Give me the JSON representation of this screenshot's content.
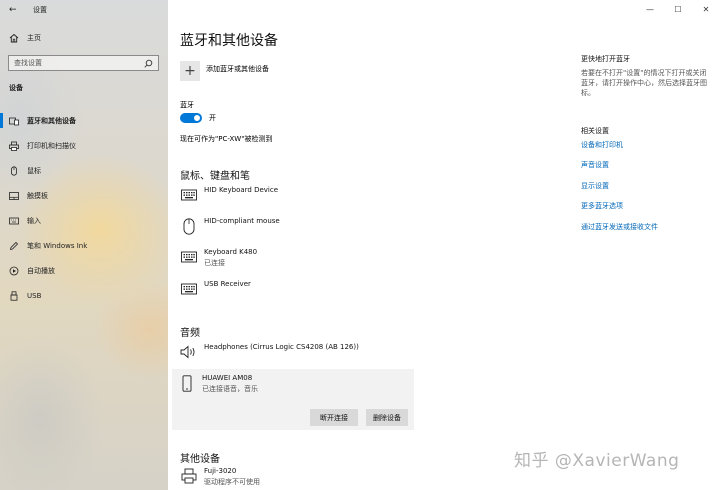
{
  "window": {
    "title": "设置",
    "back": "←",
    "controls": {
      "minimize": "—",
      "maximize": "☐",
      "close": "✕"
    }
  },
  "sidebar": {
    "home_label": "主页",
    "search_placeholder": "查找设置",
    "section_label": "设备",
    "items": [
      {
        "label": "蓝牙和其他设备",
        "icon": "bluetooth-devices-icon",
        "active": true
      },
      {
        "label": "打印机和扫描仪",
        "icon": "printer-icon"
      },
      {
        "label": "鼠标",
        "icon": "mouse-icon"
      },
      {
        "label": "触摸板",
        "icon": "touchpad-icon"
      },
      {
        "label": "输入",
        "icon": "keyboard-icon"
      },
      {
        "label": "笔和 Windows Ink",
        "icon": "pen-icon"
      },
      {
        "label": "自动播放",
        "icon": "autoplay-icon"
      },
      {
        "label": "USB",
        "icon": "usb-icon"
      }
    ]
  },
  "main": {
    "title": "蓝牙和其他设备",
    "add_device": {
      "icon": "plus-icon",
      "label": "添加蓝牙或其他设备"
    },
    "bluetooth": {
      "label": "蓝牙",
      "toggle_state": "开",
      "on": true,
      "discoverable_text": "现在可作为\"PC-XW\"被检测到"
    },
    "groups": [
      {
        "title": "鼠标、键盘和笔",
        "devices": [
          {
            "name": "HID Keyboard Device",
            "status": "",
            "icon": "keyboard-icon"
          },
          {
            "name": "HID-compliant mouse",
            "status": "",
            "icon": "mouse-icon"
          },
          {
            "name": "Keyboard K480",
            "status": "已连接",
            "icon": "keyboard-icon"
          },
          {
            "name": "USB Receiver",
            "status": "",
            "icon": "keyboard-icon"
          }
        ]
      },
      {
        "title": "音频",
        "devices": [
          {
            "name": "Headphones (Cirrus Logic CS4208 (AB 126))",
            "status": "",
            "icon": "speaker-icon"
          },
          {
            "name": "HUAWEI AM08",
            "status": "已连接语音，音乐",
            "icon": "phone-icon",
            "selected": true
          }
        ]
      },
      {
        "title": "其他设备",
        "devices": [
          {
            "name": "Fuji-3020",
            "status": "驱动程序不可使用",
            "icon": "printer-icon"
          }
        ]
      }
    ],
    "card_buttons": {
      "disconnect": "断开连接",
      "remove": "删除设备"
    }
  },
  "right_panel": {
    "faster_title": "更快地打开蓝牙",
    "faster_desc": "若要在不打开\"设置\"的情况下打开或关闭蓝牙，请打开操作中心，然后选择蓝牙图标。",
    "related_title": "相关设置",
    "links": [
      "设备和打印机",
      "声音设置",
      "显示设置",
      "更多蓝牙选项",
      "通过蓝牙发送或接收文件"
    ]
  },
  "watermark": "知乎 @XavierWang",
  "colors": {
    "accent": "#0078d7",
    "link": "#0067b8"
  }
}
